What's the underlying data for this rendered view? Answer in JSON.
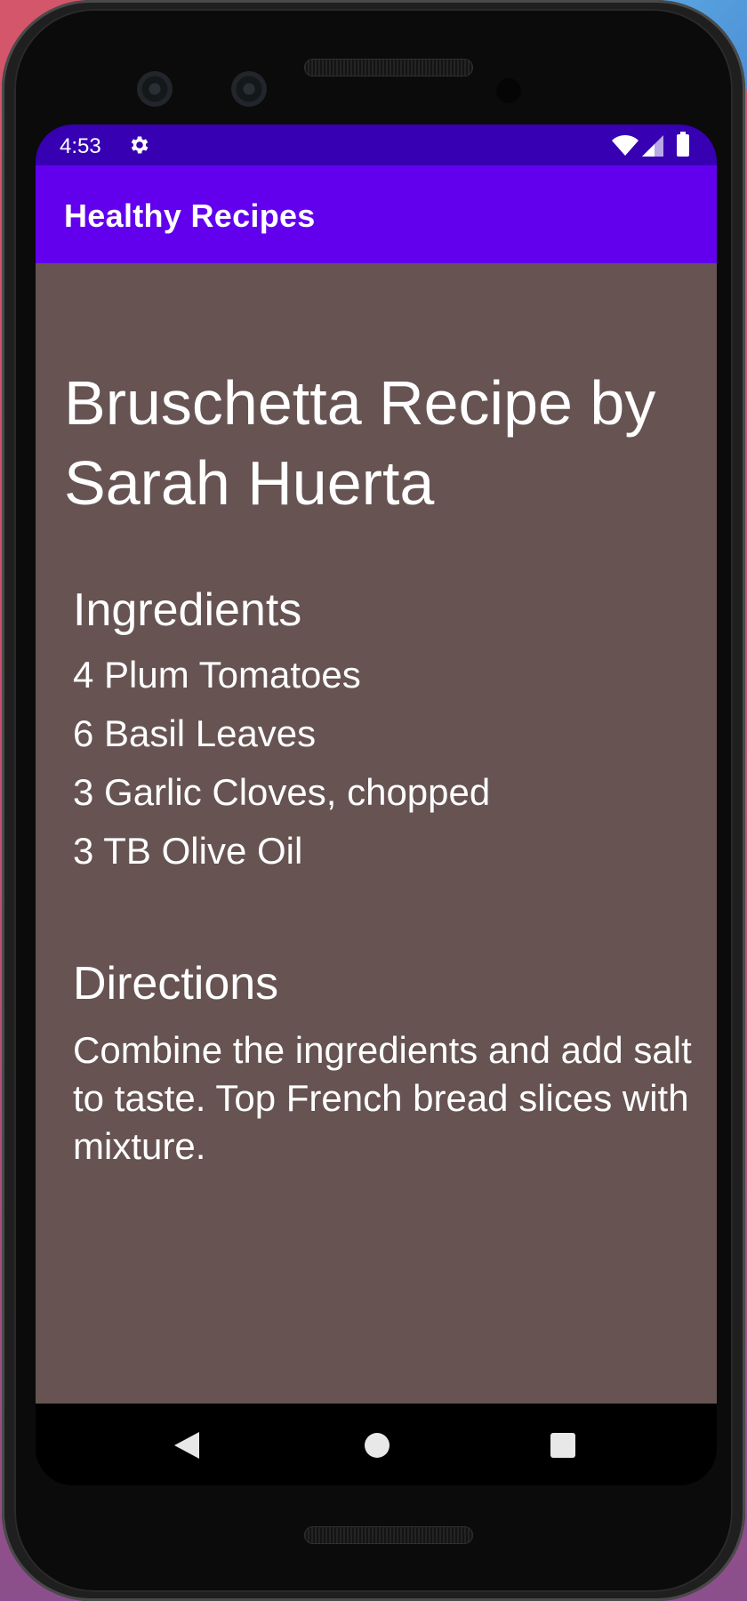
{
  "status_bar": {
    "time": "4:53",
    "icons": [
      "gear-icon",
      "wifi-icon",
      "signal-icon",
      "battery-icon"
    ]
  },
  "app_bar": {
    "title": "Healthy Recipes",
    "color": "#6200ee",
    "status_color": "#3700b3"
  },
  "recipe": {
    "title": "Bruschetta Recipe by Sarah Huerta",
    "ingredients_heading": "Ingredients",
    "ingredients": [
      "4 Plum Tomatoes",
      "6 Basil Leaves",
      "3 Garlic Cloves, chopped",
      "3 TB Olive Oil"
    ],
    "directions_heading": "Directions",
    "directions": "Combine the ingredients and add salt to taste. Top French bread slices with mixture.",
    "background_color": "#665352"
  },
  "nav_bar": {
    "icons": [
      "back-icon",
      "home-icon",
      "recents-icon"
    ]
  }
}
